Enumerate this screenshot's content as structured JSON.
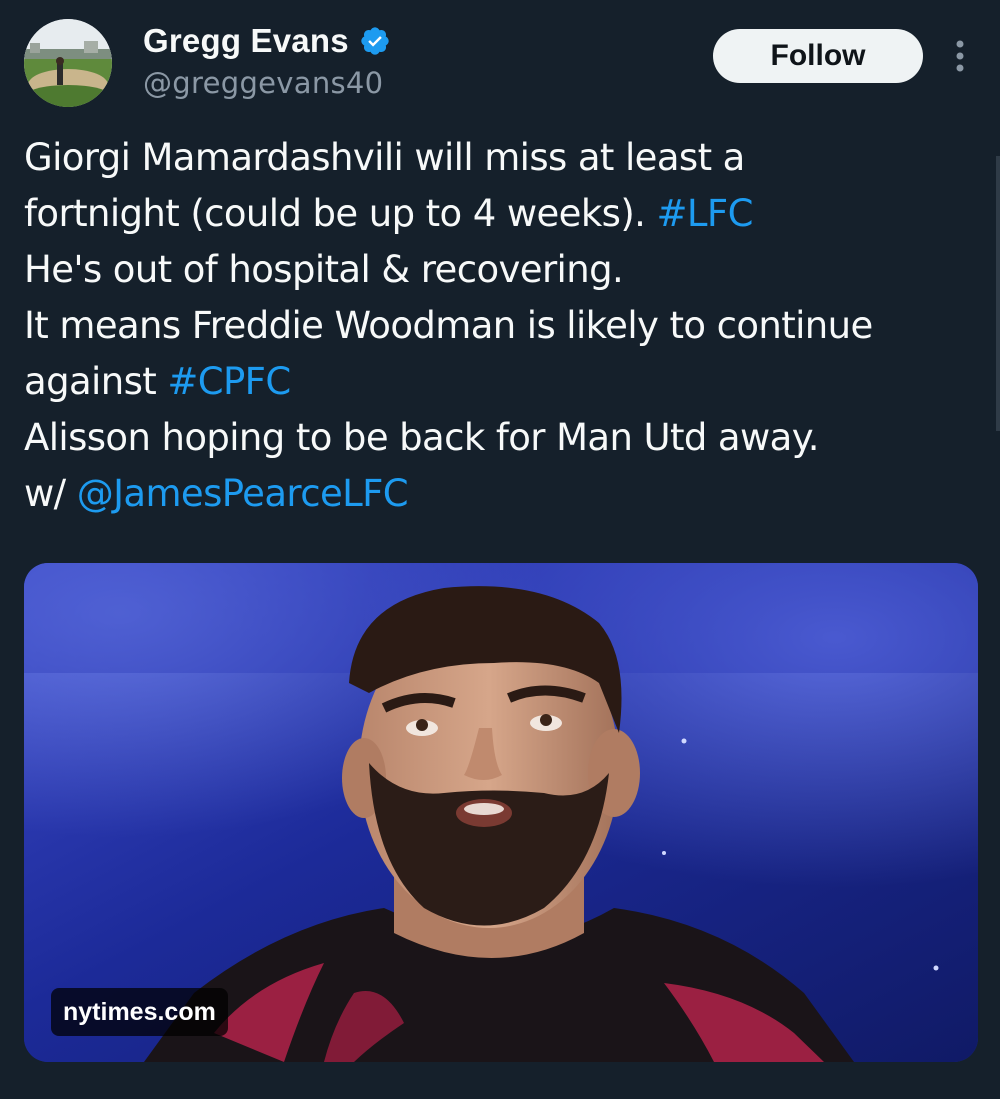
{
  "author": {
    "display_name": "Gregg Evans",
    "handle": "@greggevans40",
    "verified": true,
    "verified_icon": "verified-badge-icon",
    "avatar_icon": "avatar"
  },
  "actions": {
    "follow_label": "Follow",
    "more_icon": "more-vertical-icon"
  },
  "tweet": {
    "lines": [
      {
        "text": "Giorgi Mamardashvili will miss at least a"
      },
      {
        "text": "fortnight (could be up to 4 weeks). ",
        "link": "#LFC"
      },
      {
        "text": "He's out of hospital & recovering."
      },
      {
        "text": "It means Freddie Woodman is likely to continue"
      },
      {
        "text": "against ",
        "link": "#CPFC"
      },
      {
        "text": "Alisson hoping to be back for Man Utd away."
      },
      {
        "text": "w/ ",
        "link": "@JamesPearceLFC"
      }
    ]
  },
  "media": {
    "source": "nytimes.com"
  },
  "colors": {
    "background": "#15202b",
    "text": "#f7f9f9",
    "secondary_text": "#8b98a5",
    "link": "#1d9bf0",
    "verified": "#1d9bf0",
    "follow_bg": "#eff3f4"
  }
}
